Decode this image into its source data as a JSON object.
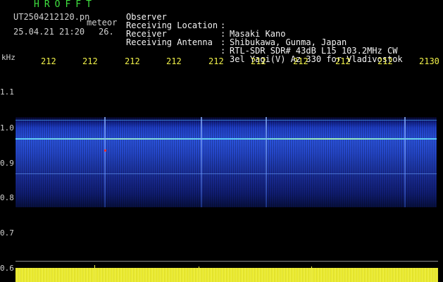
{
  "header": {
    "app_title": "HROFFT",
    "file_name": "UT2504212120.pn",
    "meteor_label": "meteor",
    "timestamp": "25.04.21 21:20",
    "counter": "26."
  },
  "info": [
    {
      "key": "Observer",
      "sep": ":",
      "value": "Masaki Kano"
    },
    {
      "key": "Receiving Location",
      "sep": ":",
      "value": "Shibukawa, Gunma, Japan"
    },
    {
      "key": "Receiver",
      "sep": ":",
      "value": "RTL-SDR SDR# 43dB L15 103.2MHz CW"
    },
    {
      "key": "Receiving Antenna",
      "sep": ":",
      "value": "3el Yagi(V) Az 330 for Vladivostok"
    }
  ],
  "y_axis": {
    "unit": "kHz",
    "ticks": [
      "1.1",
      "1.0",
      "0.9",
      "0.8",
      "0.7",
      "0.6"
    ]
  },
  "x_axis": {
    "ticks": [
      "212",
      "212",
      "212",
      "212",
      "212",
      "212",
      "212",
      "212",
      "212",
      "2130"
    ]
  },
  "colors": {
    "title": "#3fe03f",
    "info_text": "#f4f4f4",
    "time_ticks": "#f2f24a",
    "noise": "#f1f135",
    "spectrum": "#2a52da"
  }
}
